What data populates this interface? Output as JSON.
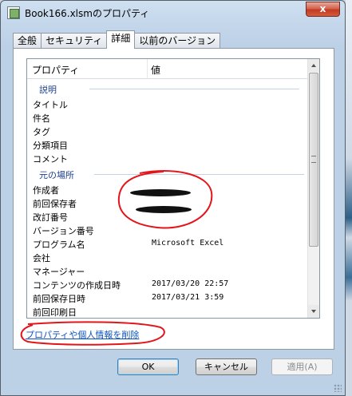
{
  "window": {
    "title": "Book166.xlsmのプロパティ",
    "close_label": "x"
  },
  "tabs": [
    {
      "label": "全般"
    },
    {
      "label": "セキュリティ"
    },
    {
      "label": "詳細"
    },
    {
      "label": "以前のバージョン"
    }
  ],
  "list": {
    "header": {
      "property": "プロパティ",
      "value": "値"
    },
    "group1": "説明",
    "group1_rows": [
      {
        "k": "タイトル",
        "v": ""
      },
      {
        "k": "件名",
        "v": ""
      },
      {
        "k": "タグ",
        "v": ""
      },
      {
        "k": "分類項目",
        "v": ""
      },
      {
        "k": "コメント",
        "v": ""
      }
    ],
    "group2": "元の場所",
    "group2_rows": [
      {
        "k": "作成者",
        "v": ""
      },
      {
        "k": "前回保存者",
        "v": ""
      },
      {
        "k": "改訂番号",
        "v": ""
      },
      {
        "k": "バージョン番号",
        "v": ""
      },
      {
        "k": "プログラム名",
        "v": "Microsoft Excel"
      },
      {
        "k": "会社",
        "v": ""
      },
      {
        "k": "マネージャー",
        "v": ""
      },
      {
        "k": "コンテンツの作成日時",
        "v": "2017/03/20 22:57"
      },
      {
        "k": "前回保存日時",
        "v": "2017/03/21 3:59"
      },
      {
        "k": "前回印刷日",
        "v": ""
      }
    ]
  },
  "remove_link": "プロパティや個人情報を削除",
  "buttons": {
    "ok": "OK",
    "cancel": "キャンセル",
    "apply": "適用(A)"
  },
  "colors": {
    "annotation_red": "#e3151a",
    "link_blue": "#0b53c4",
    "group_blue": "#1e3f8a"
  }
}
